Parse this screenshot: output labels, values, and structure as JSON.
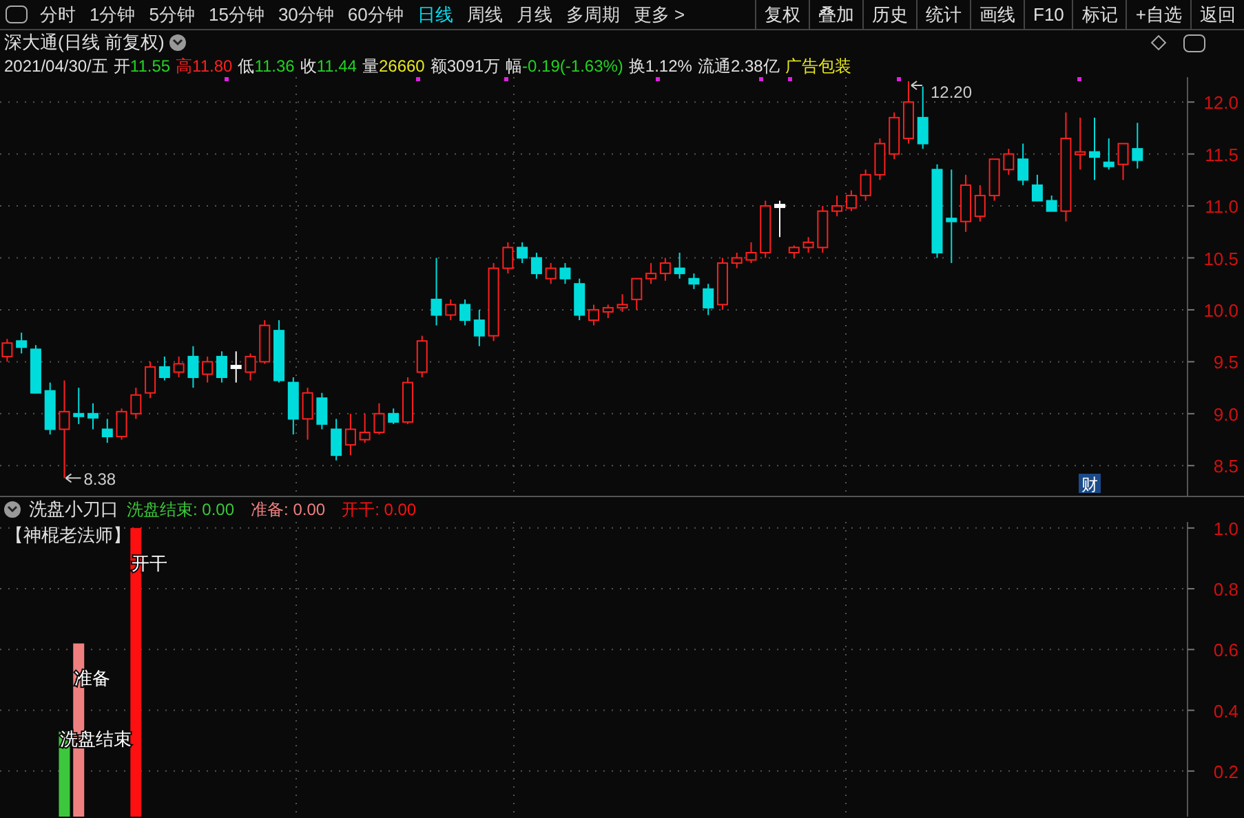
{
  "toolbar": {
    "periods": [
      {
        "label": "分时",
        "selected": false
      },
      {
        "label": "1分钟",
        "selected": false
      },
      {
        "label": "5分钟",
        "selected": false
      },
      {
        "label": "15分钟",
        "selected": false
      },
      {
        "label": "30分钟",
        "selected": false
      },
      {
        "label": "60分钟",
        "selected": false
      },
      {
        "label": "日线",
        "selected": true
      },
      {
        "label": "周线",
        "selected": false
      },
      {
        "label": "月线",
        "selected": false
      },
      {
        "label": "多周期",
        "selected": false
      },
      {
        "label": "更多 >",
        "selected": false
      }
    ],
    "buttons": [
      "复权",
      "叠加",
      "历史",
      "统计",
      "画线",
      "F10",
      "标记",
      "+自选",
      "返回"
    ]
  },
  "stock": {
    "title": "深大通(日线 前复权)",
    "quote": [
      {
        "label": "2021/04/30/五",
        "color": "#e0e0e0"
      },
      {
        "label": "开",
        "value": "11.55",
        "color": "#22d322"
      },
      {
        "label": "高",
        "value": "11.80",
        "color": "#ff2020"
      },
      {
        "label": "低",
        "value": "11.36",
        "color": "#22d322"
      },
      {
        "label": "收",
        "value": "11.44",
        "color": "#22d322"
      },
      {
        "label": "量",
        "value": "26660",
        "color": "#e8e820"
      },
      {
        "label": "额",
        "value": "3091万",
        "color": "#e0e0e0"
      },
      {
        "label": "幅",
        "value": "-0.19(-1.63%)",
        "color": "#22d322"
      },
      {
        "label": "换",
        "value": "1.12%",
        "color": "#e0e0e0"
      },
      {
        "label": "流通",
        "value": "2.38亿",
        "color": "#e0e0e0"
      },
      {
        "label": "广告包装",
        "color": "#e8e820"
      }
    ]
  },
  "price_chart": {
    "annotations": {
      "low": "8.38",
      "high": "12.20",
      "badge": "财"
    },
    "chart_data": {
      "type": "candlestick",
      "grid": true,
      "ylim": [
        8.21,
        12.24
      ],
      "categories": [
        null,
        null,
        null,
        null,
        null,
        null,
        null,
        null,
        null,
        null,
        null,
        null,
        null,
        null,
        null,
        null,
        null,
        null,
        null,
        null,
        null,
        null,
        null,
        null,
        null,
        null,
        null,
        null,
        null,
        null,
        null,
        null,
        null,
        null,
        null,
        null,
        null,
        null,
        null,
        null,
        null,
        null,
        null,
        null,
        null,
        null,
        null,
        null,
        null,
        null,
        null,
        null,
        null,
        null,
        null,
        null,
        null,
        null,
        null,
        null,
        null,
        null,
        null,
        null,
        null,
        null,
        null,
        null,
        null,
        null,
        null,
        null,
        null,
        null,
        null,
        null,
        null,
        null,
        null,
        null,
        null,
        null,
        null
      ],
      "ohlc": [
        [
          9.55,
          9.72,
          9.5,
          9.68
        ],
        [
          9.7,
          9.78,
          9.58,
          9.64
        ],
        [
          9.62,
          9.66,
          9.2,
          9.2
        ],
        [
          9.22,
          9.3,
          8.8,
          8.85
        ],
        [
          8.85,
          9.32,
          8.38,
          9.02
        ],
        [
          9.0,
          9.25,
          8.9,
          8.98
        ],
        [
          9.0,
          9.1,
          8.85,
          8.96
        ],
        [
          8.85,
          8.95,
          8.72,
          8.78
        ],
        [
          8.78,
          9.05,
          8.75,
          9.02
        ],
        [
          9.0,
          9.25,
          8.95,
          9.18
        ],
        [
          9.2,
          9.5,
          9.15,
          9.45
        ],
        [
          9.45,
          9.55,
          9.32,
          9.35
        ],
        [
          9.4,
          9.55,
          9.35,
          9.48
        ],
        [
          9.55,
          9.65,
          9.25,
          9.35
        ],
        [
          9.38,
          9.55,
          9.3,
          9.5
        ],
        [
          9.55,
          9.6,
          9.3,
          9.35
        ],
        [
          9.45,
          9.6,
          9.3,
          9.45
        ],
        [
          9.4,
          9.58,
          9.32,
          9.55
        ],
        [
          9.5,
          9.9,
          9.48,
          9.85
        ],
        [
          9.8,
          9.9,
          9.3,
          9.32
        ],
        [
          9.3,
          9.35,
          8.8,
          8.95
        ],
        [
          8.95,
          9.25,
          8.75,
          9.2
        ],
        [
          9.15,
          9.2,
          8.85,
          8.9
        ],
        [
          8.85,
          8.95,
          8.55,
          8.6
        ],
        [
          8.7,
          9.0,
          8.6,
          8.85
        ],
        [
          8.75,
          9.0,
          8.72,
          8.82
        ],
        [
          8.82,
          9.1,
          8.8,
          9.0
        ],
        [
          9.0,
          9.05,
          8.9,
          8.92
        ],
        [
          8.92,
          9.35,
          8.9,
          9.3
        ],
        [
          9.4,
          9.75,
          9.35,
          9.7
        ],
        [
          10.1,
          10.5,
          9.85,
          9.95
        ],
        [
          9.95,
          10.1,
          9.9,
          10.05
        ],
        [
          10.05,
          10.1,
          9.85,
          9.9
        ],
        [
          9.9,
          10.0,
          9.65,
          9.75
        ],
        [
          9.75,
          10.45,
          9.7,
          10.4
        ],
        [
          10.4,
          10.65,
          10.35,
          10.6
        ],
        [
          10.6,
          10.65,
          10.45,
          10.5
        ],
        [
          10.5,
          10.55,
          10.3,
          10.35
        ],
        [
          10.3,
          10.45,
          10.25,
          10.4
        ],
        [
          10.4,
          10.45,
          10.25,
          10.3
        ],
        [
          10.25,
          10.3,
          9.9,
          9.95
        ],
        [
          9.9,
          10.05,
          9.85,
          10.0
        ],
        [
          9.98,
          10.05,
          9.92,
          10.02
        ],
        [
          10.02,
          10.15,
          9.98,
          10.05
        ],
        [
          10.1,
          10.3,
          10.0,
          10.3
        ],
        [
          10.3,
          10.45,
          10.25,
          10.35
        ],
        [
          10.35,
          10.5,
          10.28,
          10.45
        ],
        [
          10.4,
          10.55,
          10.3,
          10.35
        ],
        [
          10.3,
          10.35,
          10.2,
          10.25
        ],
        [
          10.2,
          10.25,
          9.95,
          10.02
        ],
        [
          10.05,
          10.5,
          10.0,
          10.45
        ],
        [
          10.45,
          10.55,
          10.4,
          10.5
        ],
        [
          10.48,
          10.65,
          10.45,
          10.55
        ],
        [
          10.55,
          11.05,
          10.5,
          11.0
        ],
        [
          11.0,
          11.05,
          10.7,
          11.0
        ],
        [
          10.55,
          10.62,
          10.5,
          10.6
        ],
        [
          10.6,
          10.7,
          10.55,
          10.65
        ],
        [
          10.6,
          11.0,
          10.55,
          10.95
        ],
        [
          10.95,
          11.1,
          10.9,
          11.0
        ],
        [
          10.98,
          11.15,
          10.95,
          11.1
        ],
        [
          11.1,
          11.35,
          11.05,
          11.3
        ],
        [
          11.3,
          11.65,
          11.25,
          11.6
        ],
        [
          11.5,
          11.9,
          11.45,
          11.85
        ],
        [
          11.65,
          12.2,
          11.6,
          12.0
        ],
        [
          11.85,
          12.15,
          11.55,
          11.6
        ],
        [
          11.35,
          11.4,
          10.5,
          10.55
        ],
        [
          10.88,
          11.35,
          10.45,
          10.85
        ],
        [
          10.85,
          11.3,
          10.75,
          11.2
        ],
        [
          10.9,
          11.2,
          10.85,
          11.1
        ],
        [
          11.1,
          11.45,
          11.05,
          11.45
        ],
        [
          11.35,
          11.55,
          11.3,
          11.5
        ],
        [
          11.45,
          11.6,
          11.2,
          11.25
        ],
        [
          11.2,
          11.3,
          11.05,
          11.05
        ],
        [
          11.05,
          11.1,
          10.95,
          10.95
        ],
        [
          10.95,
          11.9,
          10.85,
          11.65
        ],
        [
          11.5,
          11.85,
          11.35,
          11.52
        ],
        [
          11.52,
          11.85,
          11.25,
          11.47
        ],
        [
          11.42,
          11.65,
          11.35,
          11.38
        ],
        [
          11.4,
          11.6,
          11.25,
          11.6
        ],
        [
          11.55,
          11.8,
          11.36,
          11.44
        ],
        null,
        null,
        null
      ],
      "yticks": [
        {
          "value": 12.0,
          "label": "12.0"
        },
        {
          "value": 11.5,
          "label": "11.5"
        },
        {
          "value": 11.0,
          "label": "11.0"
        },
        {
          "value": 10.5,
          "label": "10.5"
        },
        {
          "value": 10.0,
          "label": "10.0"
        },
        {
          "value": 9.5,
          "label": "9.5"
        },
        {
          "value": 9.0,
          "label": "9.0"
        },
        {
          "value": 8.5,
          "label": "8.5"
        }
      ]
    }
  },
  "indicator": {
    "name": "洗盘小刀口",
    "legend": [
      {
        "label": "洗盘结束: 0.00",
        "color": "#3cc83c"
      },
      {
        "label": "准备: 0.00",
        "color": "#f08080"
      },
      {
        "label": "开干: 0.00",
        "color": "#ff1010"
      }
    ],
    "author": "【神棍老法师】",
    "chart_data": {
      "type": "bar",
      "grid": true,
      "categories": [
        null,
        null,
        null,
        null,
        null,
        null,
        null,
        null,
        null,
        null,
        null,
        null,
        null,
        null,
        null,
        null,
        null,
        null,
        null,
        null,
        null,
        null,
        null,
        null,
        null,
        null,
        null,
        null,
        null,
        null,
        null,
        null,
        null,
        null,
        null,
        null,
        null,
        null,
        null,
        null,
        null,
        null,
        null,
        null,
        null,
        null,
        null,
        null,
        null,
        null,
        null,
        null,
        null,
        null,
        null,
        null,
        null,
        null,
        null,
        null,
        null,
        null,
        null,
        null,
        null,
        null,
        null,
        null,
        null,
        null,
        null,
        null,
        null,
        null,
        null,
        null,
        null,
        null,
        null,
        null,
        null,
        null,
        null
      ],
      "series": [
        {
          "name": "洗盘结束",
          "color": "#3cc83c",
          "values": [
            null,
            null,
            null,
            null,
            0.33,
            null,
            null,
            null,
            null,
            null,
            null,
            null,
            null,
            null,
            null,
            null,
            null,
            null,
            null,
            null,
            null,
            null,
            null,
            null,
            null,
            null,
            null,
            null,
            null,
            null,
            null,
            null,
            null,
            null,
            null,
            null,
            null,
            null,
            null,
            null,
            null,
            null,
            null,
            null,
            null,
            null,
            null,
            null,
            null,
            null,
            null,
            null,
            null,
            null,
            null,
            null,
            null,
            null,
            null,
            null,
            null,
            null,
            null,
            null,
            null,
            null,
            null,
            null,
            null,
            null,
            null,
            null,
            null,
            null,
            null,
            null,
            null,
            null,
            null,
            null,
            null,
            null,
            null
          ]
        },
        {
          "name": "准备",
          "color": "#f08080",
          "values": [
            null,
            null,
            null,
            null,
            null,
            0.62,
            null,
            null,
            null,
            null,
            null,
            null,
            null,
            null,
            null,
            null,
            null,
            null,
            null,
            null,
            null,
            null,
            null,
            null,
            null,
            null,
            null,
            null,
            null,
            null,
            null,
            null,
            null,
            null,
            null,
            null,
            null,
            null,
            null,
            null,
            null,
            null,
            null,
            null,
            null,
            null,
            null,
            null,
            null,
            null,
            null,
            null,
            null,
            null,
            null,
            null,
            null,
            null,
            null,
            null,
            null,
            null,
            null,
            null,
            null,
            null,
            null,
            null,
            null,
            null,
            null,
            null,
            null,
            null,
            null,
            null,
            null,
            null,
            null,
            null,
            null,
            null,
            null
          ]
        },
        {
          "name": "开干",
          "color": "#ff1010",
          "values": [
            null,
            null,
            null,
            null,
            null,
            null,
            null,
            null,
            null,
            1.0,
            null,
            null,
            null,
            null,
            null,
            null,
            null,
            null,
            null,
            null,
            null,
            null,
            null,
            null,
            null,
            null,
            null,
            null,
            null,
            null,
            null,
            null,
            null,
            null,
            null,
            null,
            null,
            null,
            null,
            null,
            null,
            null,
            null,
            null,
            null,
            null,
            null,
            null,
            null,
            null,
            null,
            null,
            null,
            null,
            null,
            null,
            null,
            null,
            null,
            null,
            null,
            null,
            null,
            null,
            null,
            null,
            null,
            null,
            null,
            null,
            null,
            null,
            null,
            null,
            null,
            null,
            null,
            null,
            null,
            null,
            null,
            null,
            null
          ]
        }
      ],
      "ylim": [
        0.05,
        1.02
      ],
      "yticks": [
        {
          "value": 1.0,
          "label": "1.0"
        },
        {
          "value": 0.8,
          "label": "0.8"
        },
        {
          "value": 0.6,
          "label": "0.6"
        },
        {
          "value": 0.4,
          "label": "0.4"
        },
        {
          "value": 0.2,
          "label": "0.2"
        }
      ]
    }
  }
}
